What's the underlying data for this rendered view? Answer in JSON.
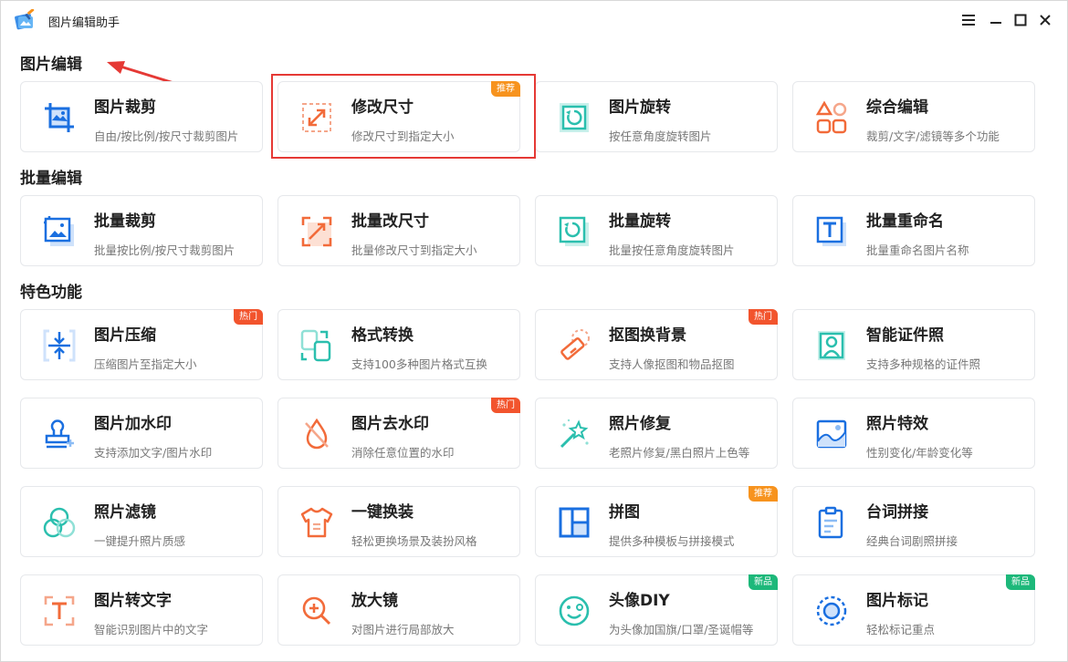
{
  "window": {
    "title": "图片编辑助手",
    "controls": [
      "menu",
      "minimize",
      "maximize",
      "close"
    ]
  },
  "sections": {
    "edit": "图片编辑",
    "batch": "批量编辑",
    "features": "特色功能"
  },
  "cards": {
    "crop": {
      "title": "图片裁剪",
      "desc": "自由/按比例/按尺寸裁剪图片",
      "icon": "crop-icon"
    },
    "resize": {
      "title": "修改尺寸",
      "desc": "修改尺寸到指定大小",
      "badge": "推荐",
      "icon": "resize-icon"
    },
    "rotate": {
      "title": "图片旋转",
      "desc": "按任意角度旋转图片",
      "icon": "rotate-icon"
    },
    "combo": {
      "title": "综合编辑",
      "desc": "裁剪/文字/滤镜等多个功能",
      "icon": "shapes-icon"
    },
    "batch_crop": {
      "title": "批量裁剪",
      "desc": "批量按比例/按尺寸裁剪图片",
      "icon": "batch-crop-icon"
    },
    "batch_resize": {
      "title": "批量改尺寸",
      "desc": "批量修改尺寸到指定大小",
      "icon": "batch-resize-icon"
    },
    "batch_rotate": {
      "title": "批量旋转",
      "desc": "批量按任意角度旋转图片",
      "icon": "batch-rotate-icon"
    },
    "batch_rename": {
      "title": "批量重命名",
      "desc": "批量重命名图片名称",
      "icon": "rename-icon"
    },
    "compress": {
      "title": "图片压缩",
      "desc": "压缩图片至指定大小",
      "badge": "热门",
      "icon": "compress-icon"
    },
    "convert": {
      "title": "格式转换",
      "desc": "支持100多种图片格式互换",
      "icon": "convert-icon"
    },
    "cutout": {
      "title": "抠图换背景",
      "desc": "支持人像抠图和物品抠图",
      "badge": "热门",
      "icon": "eraser-icon"
    },
    "id_photo": {
      "title": "智能证件照",
      "desc": "支持多种规格的证件照",
      "icon": "id-photo-icon"
    },
    "watermark_add": {
      "title": "图片加水印",
      "desc": "支持添加文字/图片水印",
      "icon": "stamp-icon"
    },
    "watermark_remove": {
      "title": "图片去水印",
      "desc": "消除任意位置的水印",
      "badge": "热门",
      "icon": "drop-off-icon"
    },
    "repair": {
      "title": "照片修复",
      "desc": "老照片修复/黑白照片上色等",
      "icon": "magic-wand-icon"
    },
    "effects": {
      "title": "照片特效",
      "desc": "性别变化/年龄变化等",
      "icon": "landscape-icon"
    },
    "filter": {
      "title": "照片滤镜",
      "desc": "一键提升照片质感",
      "icon": "filter-circles-icon"
    },
    "outfit": {
      "title": "一键换装",
      "desc": "轻松更换场景及装扮风格",
      "icon": "shirt-icon"
    },
    "collage": {
      "title": "拼图",
      "desc": "提供多种模板与拼接模式",
      "badge": "推荐",
      "icon": "collage-icon"
    },
    "lines": {
      "title": "台词拼接",
      "desc": "经典台词剧照拼接",
      "icon": "clipboard-icon"
    },
    "ocr": {
      "title": "图片转文字",
      "desc": "智能识别图片中的文字",
      "icon": "text-scan-icon"
    },
    "magnifier": {
      "title": "放大镜",
      "desc": "对图片进行局部放大",
      "icon": "zoom-in-icon"
    },
    "avatar": {
      "title": "头像DIY",
      "desc": "为头像加国旗/口罩/圣诞帽等",
      "badge": "新品",
      "icon": "smiley-icon"
    },
    "mark": {
      "title": "图片标记",
      "desc": "轻松标记重点",
      "badge": "新品",
      "icon": "target-icon"
    }
  },
  "colors": {
    "blue": "#1a6fe0",
    "orange": "#f26b3a",
    "teal": "#2bbfae",
    "highlight": "#e53935"
  }
}
